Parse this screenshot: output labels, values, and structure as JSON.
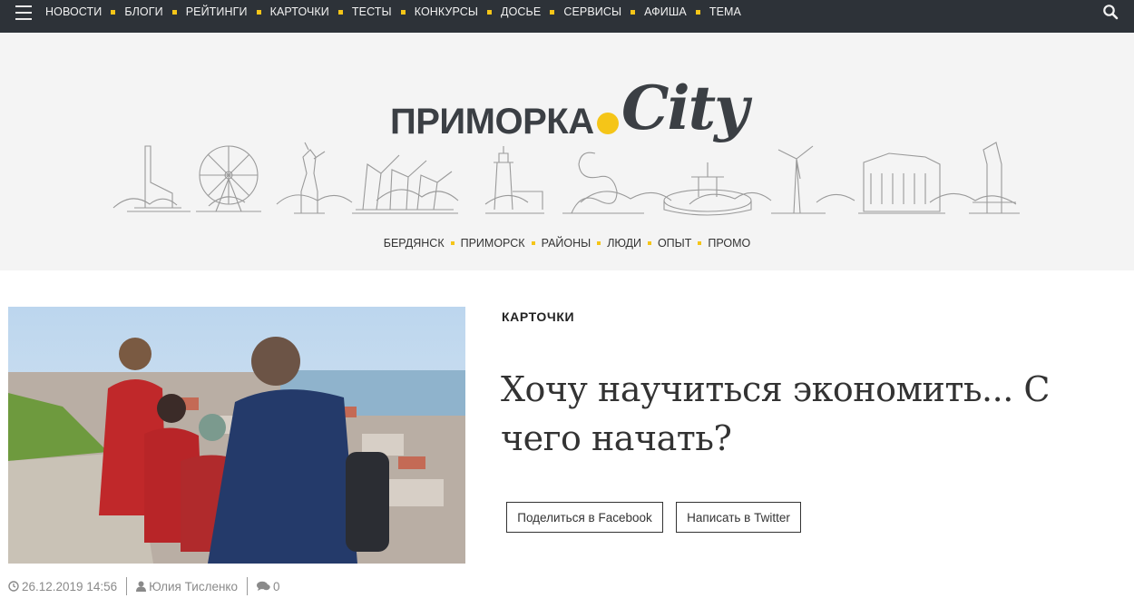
{
  "topnav": {
    "items": [
      "НОВОСТИ",
      "БЛОГИ",
      "РЕЙТИНГИ",
      "КАРТОЧКИ",
      "ТЕСТЫ",
      "КОНКУРСЫ",
      "ДОСЬЕ",
      "СЕРВИСЫ",
      "АФИША",
      "ТЕМА"
    ],
    "menu_icon": "hamburger-icon",
    "search_icon": "search-icon"
  },
  "logo": {
    "word": "ПРИМОРКА",
    "script": "City"
  },
  "subnav": {
    "items": [
      "БЕРДЯНСК",
      "ПРИМОРСК",
      "РАЙОНЫ",
      "ЛЮДИ",
      "ОПЫТ",
      "ПРОМО"
    ]
  },
  "article": {
    "category": "КАРТОЧКИ",
    "title": "Хочу научиться экономить... С чего начать?",
    "share_facebook": "Поделиться в Facebook",
    "share_twitter": "Написать в Twitter",
    "date": "26.12.2019 14:56",
    "author": "Юлия Тисленко",
    "comments": "0"
  },
  "colors": {
    "nav_bg": "#2d3238",
    "accent": "#f5c518",
    "header_bg": "#f4f4f4"
  }
}
